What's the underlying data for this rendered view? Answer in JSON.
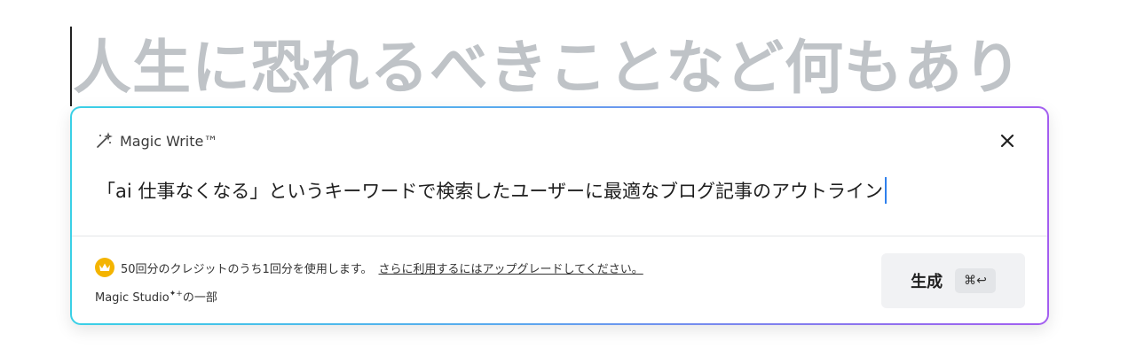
{
  "heading": {
    "text": "人生に恐れるべきことなど何もあり"
  },
  "panel": {
    "title": "Magic Write™",
    "prompt_text": "「ai 仕事なくなる」というキーワードで検索したユーザーに最適なブログ記事のアウトライン",
    "credits_text": "50回分のクレジットのうち1回分を使用します。",
    "upgrade_link": "さらに利用するにはアップグレードしてください。",
    "studio_prefix": "Magic Studio",
    "studio_sparkle": "✦+",
    "studio_suffix": "の一部",
    "generate_label": "生成",
    "shortcut": "⌘↩"
  },
  "colors": {
    "heading": "#bfc3c7",
    "crown": "#f4b400",
    "caret": "#2f80ed"
  },
  "icons": [
    "wand-icon",
    "close-icon",
    "crown-icon"
  ]
}
